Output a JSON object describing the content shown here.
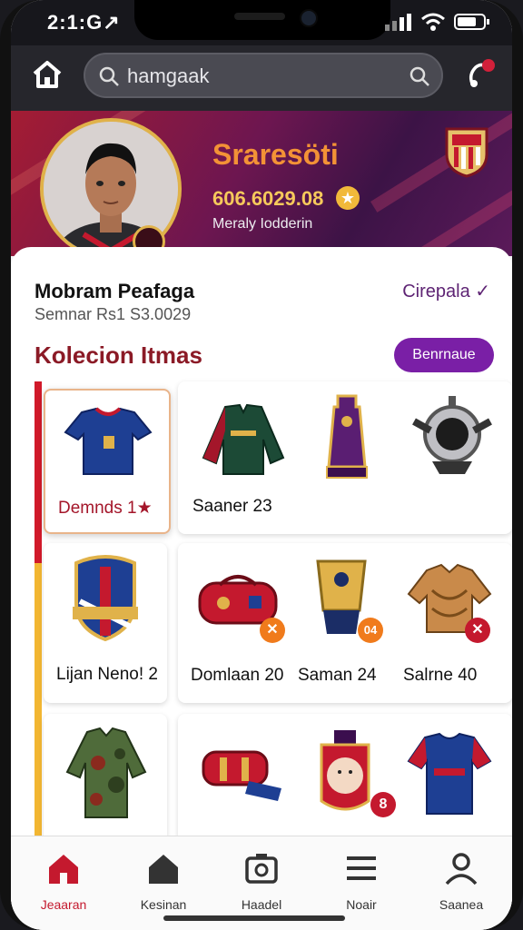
{
  "status_bar": {
    "time": "2:1:G↗"
  },
  "search": {
    "value": "hamgaak"
  },
  "hero": {
    "name": "Sraresöti",
    "coins": "606.6029.08",
    "subtitle": "Meraly Iodderin"
  },
  "profile": {
    "username": "Mobram Peafaga",
    "user_id": "Semnar Rs1 S3.0029",
    "status": "Cirepala ✓"
  },
  "section": {
    "title": "Kolecion Itmas",
    "button": "Benrnaue"
  },
  "items": [
    {
      "icon": "blue-jersey-icon",
      "label": "Demnds 1★"
    },
    {
      "icon": "track-jacket-icon",
      "label": ""
    },
    {
      "icon": "trophy-icon",
      "label": ""
    },
    {
      "icon": "whistle-icon",
      "label": ""
    },
    {
      "icon": "crest-badge-icon",
      "label": "Lijan Neno! 2"
    },
    {
      "icon": "red-bag-icon",
      "label": "Domlaan 20"
    },
    {
      "icon": "golden-cup-icon",
      "label": "Saman 24"
    },
    {
      "icon": "vest-icon",
      "label": "Salrne 40"
    },
    {
      "icon": "camo-shirt-icon",
      "label": ""
    },
    {
      "icon": "scarf-icon",
      "label": ""
    },
    {
      "icon": "mascot-icon",
      "label": ""
    },
    {
      "icon": "red-jersey-icon",
      "label": ""
    }
  ],
  "row1_label": "Saaner 23",
  "nav": [
    {
      "label": "Jeaaran",
      "icon": "home-icon"
    },
    {
      "label": "Kesinan",
      "icon": "house-icon"
    },
    {
      "label": "Haadel",
      "icon": "camera-icon"
    },
    {
      "label": "Noair",
      "icon": "menu-icon"
    },
    {
      "label": "Saanea",
      "icon": "profile-icon"
    }
  ],
  "colors": {
    "accent": "#7a1fa6",
    "brand_red": "#c4192e",
    "gold": "#f39236"
  }
}
